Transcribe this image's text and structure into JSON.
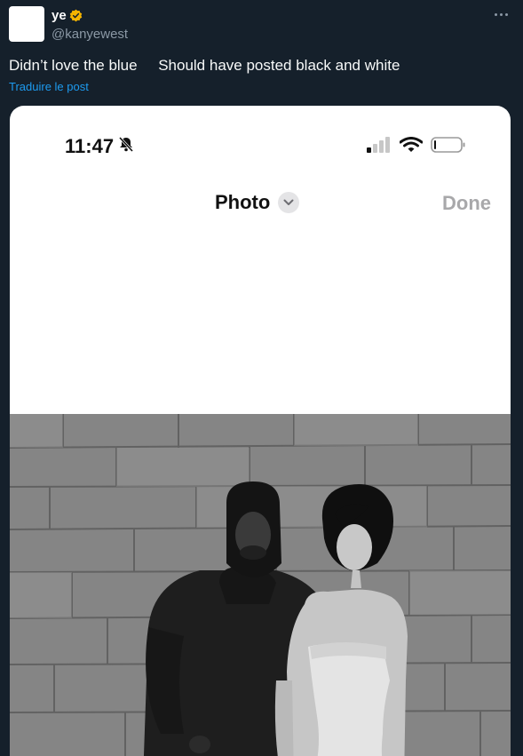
{
  "author": {
    "display_name": "ye",
    "handle": "@kanyewest",
    "verified_icon": "verified-badge-icon",
    "verified_color": "#f4b400"
  },
  "tweet": {
    "text": "Didn’t love the blue     Should have posted black and white",
    "translate_label": "Traduire le post"
  },
  "phone_screenshot": {
    "time": "11:47",
    "silent_icon": "bell-slash-icon",
    "signal_icon": "cellular-signal-icon",
    "wifi_icon": "wifi-icon",
    "battery_icon": "battery-icon",
    "nav_title": "Photo",
    "nav_chevron_icon": "chevron-down-icon",
    "done_label": "Done"
  },
  "photo": {
    "description_icon": "photo",
    "style": "black-and-white"
  },
  "colors": {
    "background": "#15202b",
    "link": "#1d9bf0",
    "secondary_text": "#8b98a5"
  }
}
